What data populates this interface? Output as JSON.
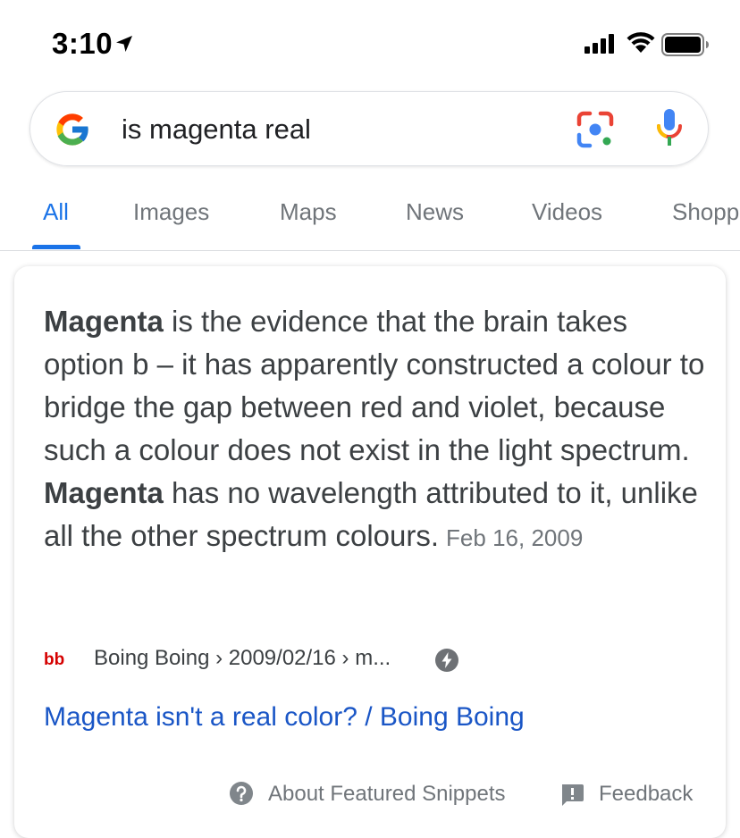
{
  "status_bar": {
    "time": "3:10",
    "location_icon": "location-arrow-icon",
    "signal_icon": "cellular-signal-icon",
    "wifi_icon": "wifi-icon",
    "battery_icon": "battery-icon"
  },
  "search": {
    "query": "is magenta real",
    "logo_icon": "google-g-logo",
    "lens_icon": "google-lens-icon",
    "mic_icon": "microphone-icon"
  },
  "tabs": [
    {
      "label": "All",
      "active": true
    },
    {
      "label": "Images",
      "active": false
    },
    {
      "label": "Maps",
      "active": false
    },
    {
      "label": "News",
      "active": false
    },
    {
      "label": "Videos",
      "active": false
    },
    {
      "label": "Shopping",
      "active": false
    }
  ],
  "snippet": {
    "term_1": "Magenta",
    "text_1": " is the evidence that the brain takes option b – it has apparently constructed a colour to bridge the gap between red and violet, because such a colour does not exist in the light spectrum. ",
    "term_2": "Magenta",
    "text_2": " has no wavelength attributed to it, unlike all the other spectrum colours.",
    "date": "Feb 16, 2009",
    "source_favicon": "bb",
    "breadcrumb": "Boing Boing › 2009/02/16 › m...",
    "amp_icon": "amp-lightning-icon",
    "link_title": "Magenta isn't a real color? / Boing Boing"
  },
  "footer": {
    "about_label": "About Featured Snippets",
    "feedback_label": "Feedback",
    "help_icon": "help-circle-icon",
    "feedback_icon": "feedback-icon"
  },
  "colors": {
    "link_blue": "#1a73e8",
    "result_link": "#1a56c6",
    "text_gray": "#70757a",
    "favicon_red": "#d50000"
  }
}
